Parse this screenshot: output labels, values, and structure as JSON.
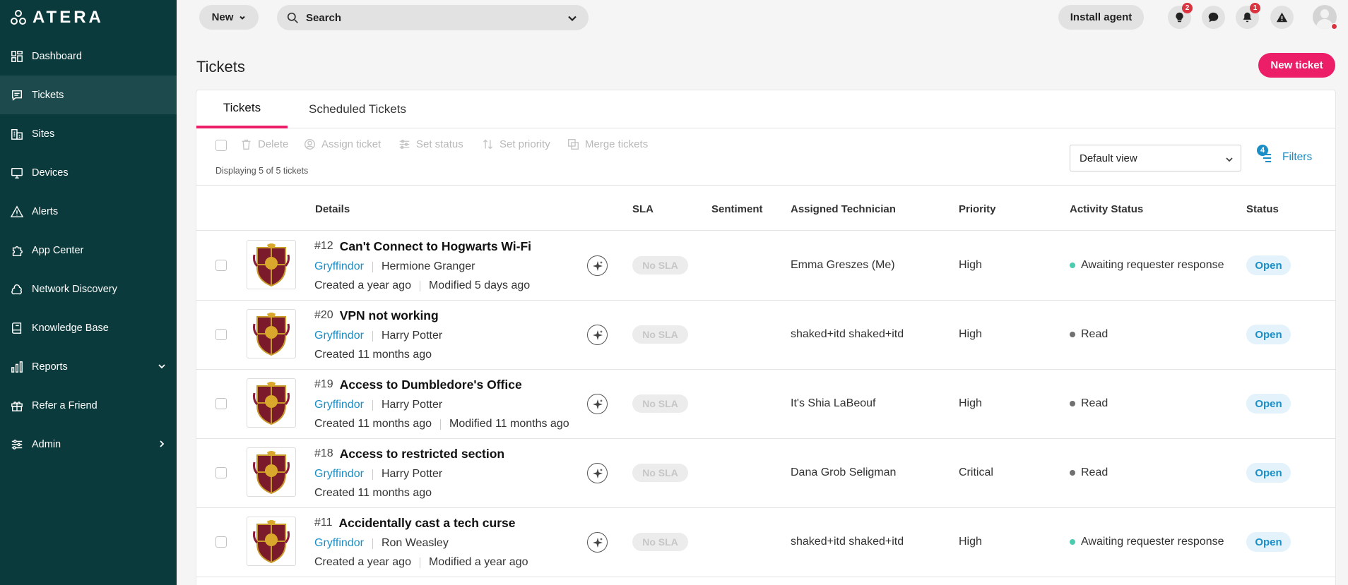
{
  "brand": {
    "name": "ATERA"
  },
  "sidebar": {
    "items": [
      {
        "label": "Dashboard",
        "icon": "dashboard-icon"
      },
      {
        "label": "Tickets",
        "icon": "tickets-icon"
      },
      {
        "label": "Sites",
        "icon": "sites-icon"
      },
      {
        "label": "Devices",
        "icon": "devices-icon"
      },
      {
        "label": "Alerts",
        "icon": "alerts-icon"
      },
      {
        "label": "App Center",
        "icon": "app-center-icon"
      },
      {
        "label": "Network Discovery",
        "icon": "network-discovery-icon"
      },
      {
        "label": "Knowledge Base",
        "icon": "knowledge-base-icon"
      },
      {
        "label": "Reports",
        "icon": "reports-icon"
      },
      {
        "label": "Refer a Friend",
        "icon": "gift-icon"
      },
      {
        "label": "Admin",
        "icon": "admin-icon"
      }
    ],
    "active": "Tickets"
  },
  "topbar": {
    "new_label": "New",
    "search_placeholder": "Search",
    "install_label": "Install agent",
    "lightbulb_badge": "2",
    "bell_badge": "1"
  },
  "page": {
    "title": "Tickets",
    "new_ticket_label": "New ticket"
  },
  "tabs": [
    {
      "label": "Tickets"
    },
    {
      "label": "Scheduled Tickets"
    }
  ],
  "toolbar": {
    "delete": "Delete",
    "assign": "Assign ticket",
    "set_status": "Set status",
    "set_priority": "Set priority",
    "merge": "Merge tickets",
    "displaying": "Displaying 5 of 5 tickets",
    "view": "Default view",
    "filters_label": "Filters",
    "filters_count": "4"
  },
  "columns": {
    "details": "Details",
    "sla": "SLA",
    "sentiment": "Sentiment",
    "technician": "Assigned Technician",
    "priority": "Priority",
    "activity": "Activity Status",
    "status": "Status"
  },
  "colors": {
    "accent": "#ec1e67",
    "link": "#1a8fc7",
    "sidebar": "#0b3a3c",
    "activity_green": "#4ccbb0",
    "activity_gray": "#707070"
  },
  "tickets": [
    {
      "num": "#12",
      "title": "Can't Connect to Hogwarts Wi-Fi",
      "site": "Gryffindor",
      "user": "Hermione Granger",
      "created": "Created a year ago",
      "modified": "Modified 5 days ago",
      "sla": "No SLA",
      "tech": "Emma Greszes (Me)",
      "priority": "High",
      "activity": "Awaiting requester response",
      "activity_color": "#4ccbb0",
      "status": "Open"
    },
    {
      "num": "#20",
      "title": "VPN not working",
      "site": "Gryffindor",
      "user": "Harry Potter",
      "created": "Created 11 months ago",
      "modified": "",
      "sla": "No SLA",
      "tech": "shaked+itd shaked+itd",
      "priority": "High",
      "activity": "Read",
      "activity_color": "#707070",
      "status": "Open"
    },
    {
      "num": "#19",
      "title": "Access to Dumbledore's Office",
      "site": "Gryffindor",
      "user": "Harry Potter",
      "created": "Created 11 months ago",
      "modified": "Modified 11 months ago",
      "sla": "No SLA",
      "tech": "It's Shia LaBeouf",
      "priority": "High",
      "activity": "Read",
      "activity_color": "#707070",
      "status": "Open"
    },
    {
      "num": "#18",
      "title": "Access to restricted section",
      "site": "Gryffindor",
      "user": "Harry Potter",
      "created": "Created 11 months ago",
      "modified": "",
      "sla": "No SLA",
      "tech": "Dana Grob Seligman",
      "priority": "Critical",
      "activity": "Read",
      "activity_color": "#707070",
      "status": "Open"
    },
    {
      "num": "#11",
      "title": "Accidentally cast a tech curse",
      "site": "Gryffindor",
      "user": "Ron Weasley",
      "created": "Created a year ago",
      "modified": "Modified a year ago",
      "sla": "No SLA",
      "tech": "shaked+itd shaked+itd",
      "priority": "High",
      "activity": "Awaiting requester response",
      "activity_color": "#4ccbb0",
      "status": "Open"
    }
  ]
}
